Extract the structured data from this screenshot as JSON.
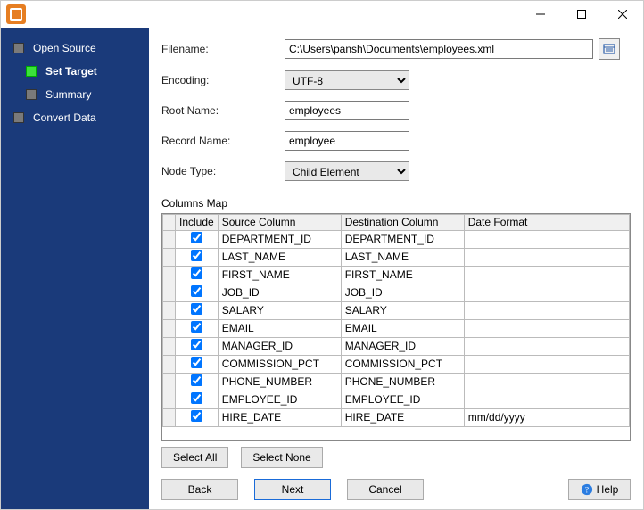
{
  "sidebar": {
    "items": [
      {
        "label": "Open Source",
        "current": false
      },
      {
        "label": "Set Target",
        "current": true
      },
      {
        "label": "Summary",
        "current": false
      },
      {
        "label": "Convert Data",
        "current": false
      }
    ]
  },
  "form": {
    "filename_label": "Filename:",
    "filename_value": "C:\\Users\\pansh\\Documents\\employees.xml",
    "encoding_label": "Encoding:",
    "encoding_value": "UTF-8",
    "root_name_label": "Root Name:",
    "root_name_value": "employees",
    "record_name_label": "Record Name:",
    "record_name_value": "employee",
    "node_type_label": "Node Type:",
    "node_type_value": "Child Element"
  },
  "columns_map": {
    "label": "Columns Map",
    "headers": {
      "include": "Include",
      "source": "Source Column",
      "destination": "Destination Column",
      "date_format": "Date Format"
    },
    "rows": [
      {
        "include": true,
        "source": "DEPARTMENT_ID",
        "destination": "DEPARTMENT_ID",
        "date_format": ""
      },
      {
        "include": true,
        "source": "LAST_NAME",
        "destination": "LAST_NAME",
        "date_format": ""
      },
      {
        "include": true,
        "source": "FIRST_NAME",
        "destination": "FIRST_NAME",
        "date_format": ""
      },
      {
        "include": true,
        "source": "JOB_ID",
        "destination": "JOB_ID",
        "date_format": ""
      },
      {
        "include": true,
        "source": "SALARY",
        "destination": "SALARY",
        "date_format": ""
      },
      {
        "include": true,
        "source": "EMAIL",
        "destination": "EMAIL",
        "date_format": ""
      },
      {
        "include": true,
        "source": "MANAGER_ID",
        "destination": "MANAGER_ID",
        "date_format": ""
      },
      {
        "include": true,
        "source": "COMMISSION_PCT",
        "destination": "COMMISSION_PCT",
        "date_format": ""
      },
      {
        "include": true,
        "source": "PHONE_NUMBER",
        "destination": "PHONE_NUMBER",
        "date_format": ""
      },
      {
        "include": true,
        "source": "EMPLOYEE_ID",
        "destination": "EMPLOYEE_ID",
        "date_format": ""
      },
      {
        "include": true,
        "source": "HIRE_DATE",
        "destination": "HIRE_DATE",
        "date_format": "mm/dd/yyyy"
      }
    ]
  },
  "buttons": {
    "select_all": "Select All",
    "select_none": "Select None",
    "back": "Back",
    "next": "Next",
    "cancel": "Cancel",
    "help": "Help"
  }
}
